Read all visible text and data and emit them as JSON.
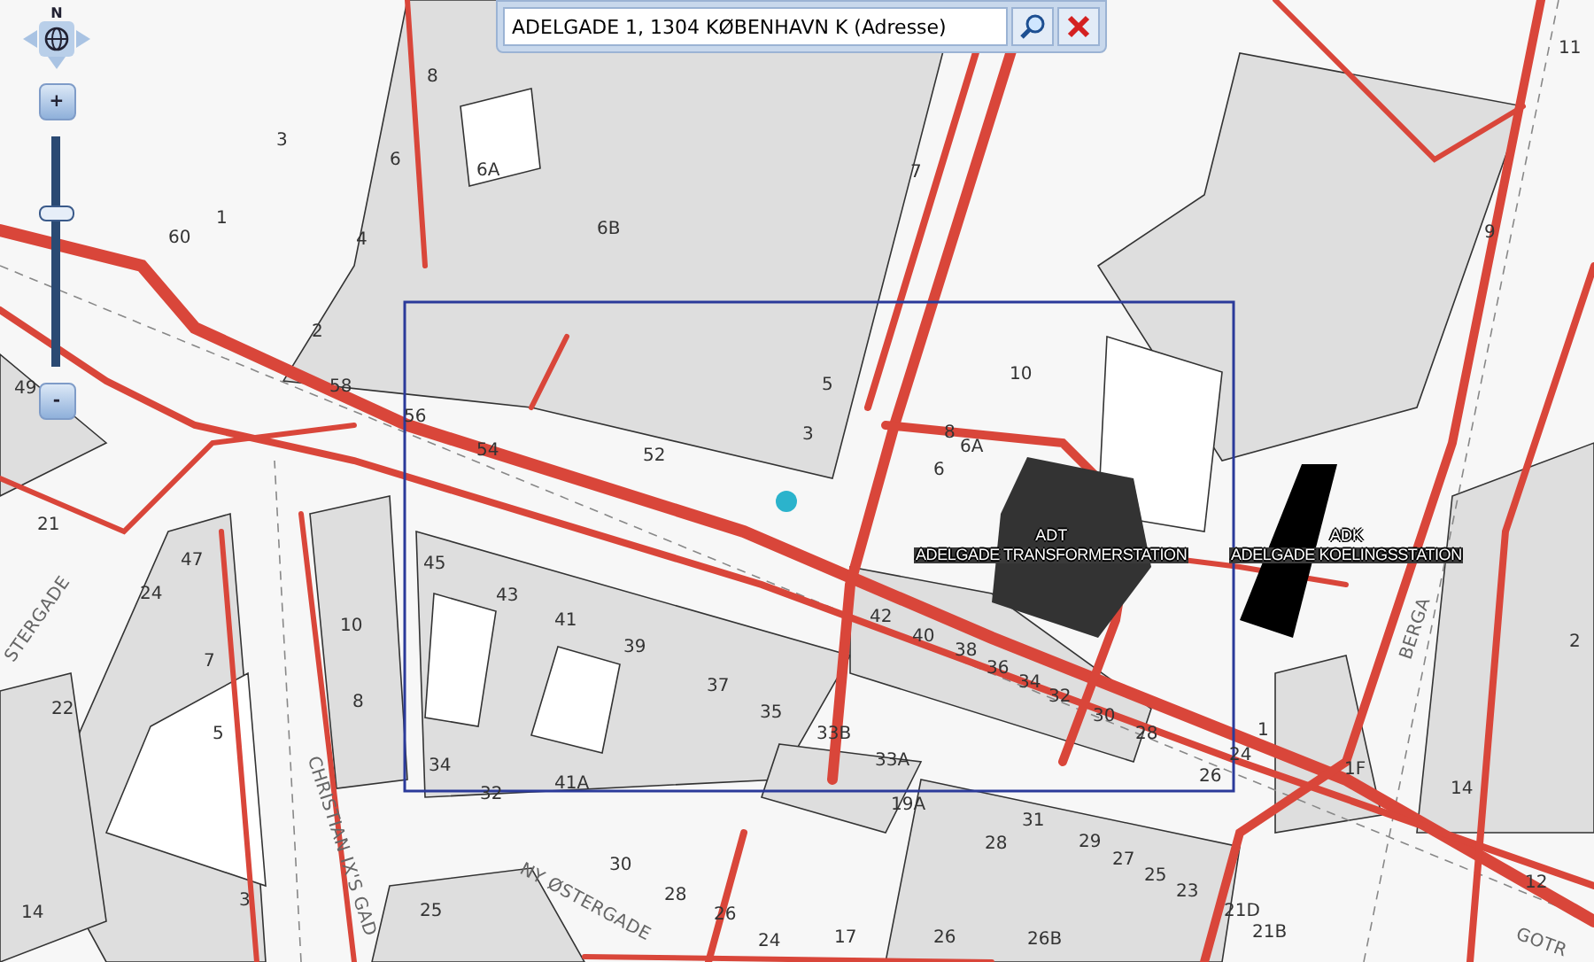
{
  "search": {
    "value": "ADELGADE 1, 1304 KØBENHAVN K (Adresse)"
  },
  "navigation": {
    "north": "N",
    "zoom_in": "+",
    "zoom_out": "-",
    "zoom": {
      "level": 0.68
    }
  },
  "map": {
    "parcel_numbers": [
      "3",
      "1",
      "60",
      "8",
      "6",
      "6A",
      "4",
      "2",
      "58",
      "56",
      "54",
      "49",
      "7",
      "6B",
      "5",
      "3",
      "52",
      "10",
      "8",
      "6A",
      "6",
      "9",
      "11",
      "21",
      "47",
      "24",
      "7",
      "22",
      "5",
      "10",
      "8",
      "3",
      "14",
      "45",
      "43",
      "41",
      "39",
      "37",
      "35",
      "34",
      "32",
      "41A",
      "30",
      "28",
      "26",
      "24",
      "25",
      "42",
      "40",
      "38",
      "36",
      "34",
      "32",
      "30",
      "28",
      "24",
      "26",
      "1",
      "1F",
      "14",
      "2",
      "33B",
      "33A",
      "19A",
      "31",
      "28",
      "29",
      "27",
      "25",
      "23",
      "21D",
      "21B",
      "17",
      "26",
      "26B",
      "12"
    ],
    "streets": [
      "STERGADE",
      "CHRISTIAN IX'S GAD",
      "NY ØSTERGADE",
      "BERGA",
      "GOTR"
    ],
    "facilities": [
      {
        "code": "ADT",
        "name": "ADELGADE TRANSFORMERSTATION"
      },
      {
        "code": "ADK",
        "name": "ADELGADE KOELINGSSTATION"
      }
    ]
  }
}
